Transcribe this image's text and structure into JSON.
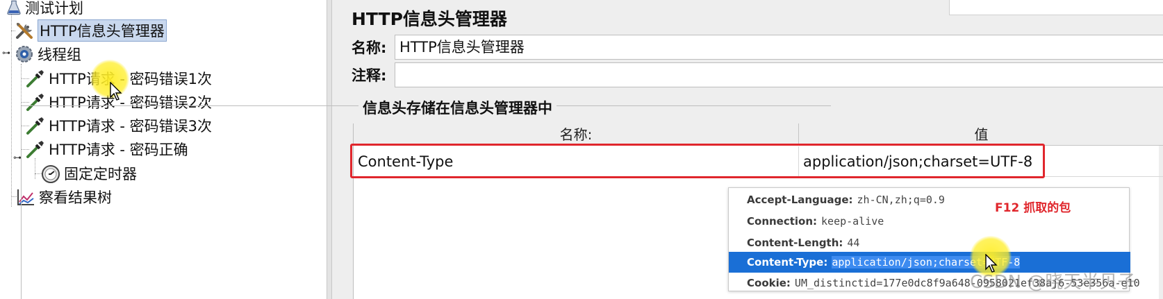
{
  "tree": {
    "root": "测试计划",
    "header_manager": "HTTP信息头管理器",
    "thread_group": "线程组",
    "requests": [
      "HTTP请求 - 密码错误1次",
      "HTTP请求 - 密码错误2次",
      "HTTP请求 - 密码错误3次",
      "HTTP请求 - 密码正确"
    ],
    "timer": "固定定时器",
    "listener": "察看结果树"
  },
  "panel": {
    "title": "HTTP信息头管理器",
    "name_label": "名称:",
    "name_value": "HTTP信息头管理器",
    "comment_label": "注释:",
    "comment_value": "",
    "group_title": "信息头存储在信息头管理器中",
    "table": {
      "headers": [
        "名称:",
        "值"
      ],
      "rows": [
        {
          "name": "Content-Type",
          "value": "application/json;charset=UTF-8"
        }
      ]
    }
  },
  "overlay": {
    "note": "F12 抓取的包",
    "rows": [
      {
        "key": "Accept-Language:",
        "value": "zh-CN,zh;q=0.9",
        "active": false
      },
      {
        "key": "Connection:",
        "value": "keep-alive",
        "active": false
      },
      {
        "key": "Content-Length:",
        "value": "44",
        "active": false
      },
      {
        "key": "Content-Type:",
        "value": "application/json;charset=UTF-8",
        "active": true
      },
      {
        "key": "Cookie:",
        "value": "UM_distinctid=177e0dc8f9a648-0958021ef38aj6-53e356a-e10",
        "active": false
      }
    ]
  },
  "watermark": "CSDN @晓天半贝子",
  "colors": {
    "highlight": "#e0262c",
    "selection": "#1a6fd6",
    "tree_selection": "#c9d8ee"
  }
}
